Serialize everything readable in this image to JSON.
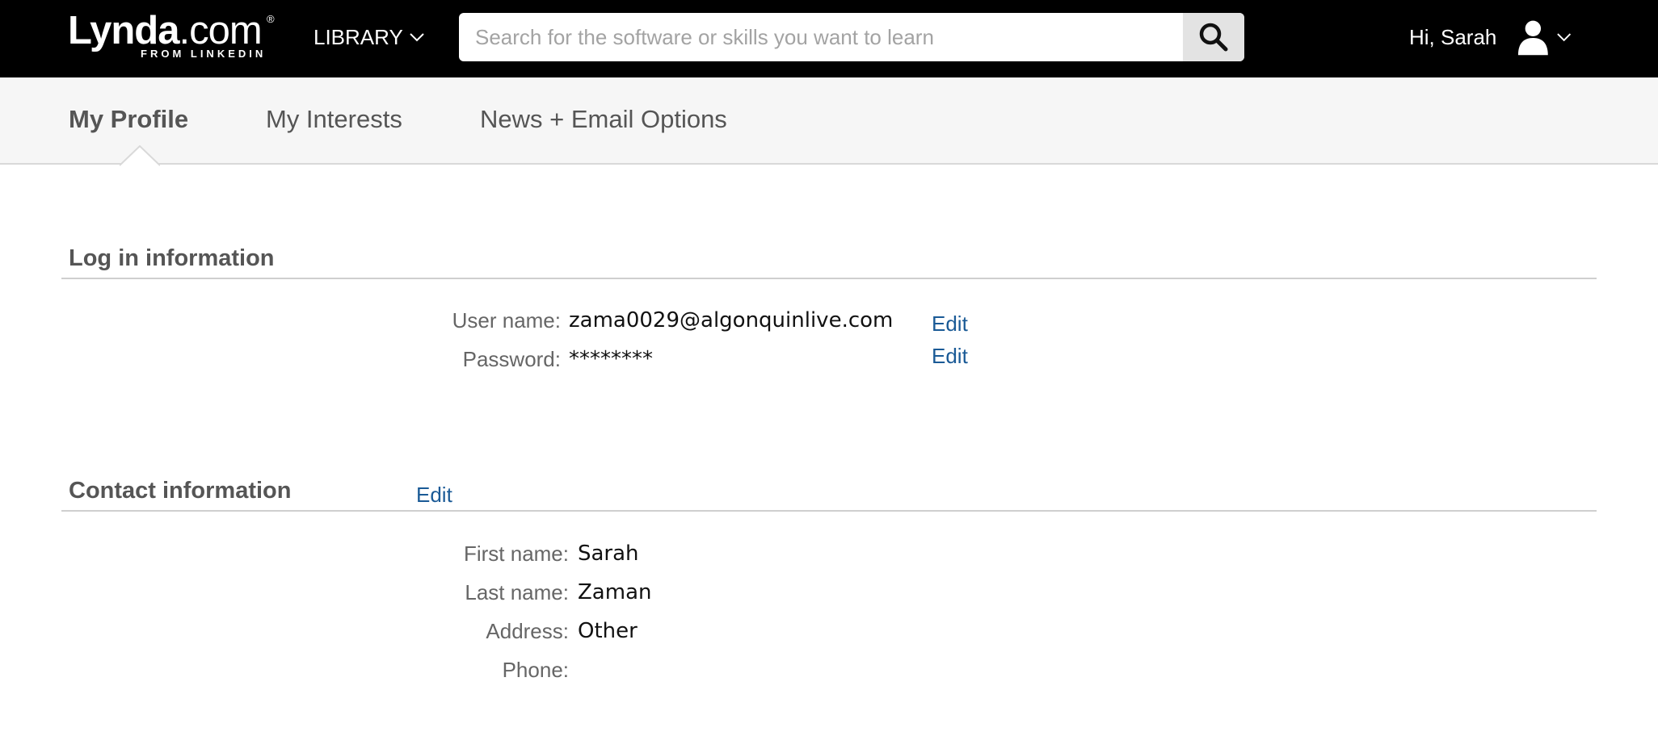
{
  "header": {
    "logo": {
      "main": "Lynda",
      "suffix": ".com",
      "registered": "®",
      "sub": "FROM LINKEDIN"
    },
    "library_label": "LIBRARY",
    "search": {
      "placeholder": "Search for the software or skills you want to learn",
      "value": ""
    },
    "greeting": "Hi, Sarah",
    "icons": {
      "library_dropdown": "chevron-down-icon",
      "search": "search-icon",
      "user": "user-icon",
      "user_dropdown": "chevron-down-icon"
    }
  },
  "tabs": [
    {
      "label": "My Profile",
      "active": true
    },
    {
      "label": "My Interests",
      "active": false
    },
    {
      "label": "News + Email Options",
      "active": false
    }
  ],
  "login_section": {
    "title": "Log in information",
    "rows": [
      {
        "label": "User name:",
        "value": "zama0029@algonquinlive.com",
        "edit": "Edit"
      },
      {
        "label": "Password:",
        "value": "********",
        "edit": "Edit"
      }
    ]
  },
  "contact_section": {
    "title": "Contact information",
    "edit": "Edit",
    "rows": [
      {
        "label": "First name:",
        "value": "Sarah"
      },
      {
        "label": "Last name:",
        "value": "Zaman"
      },
      {
        "label": "Address:",
        "value": "Other"
      },
      {
        "label": "Phone:",
        "value": ""
      }
    ]
  },
  "colors": {
    "topbar": "#000000",
    "link": "#1a5a96",
    "tab_bar": "#f6f6f6",
    "search_button": "#e3e3e3"
  }
}
